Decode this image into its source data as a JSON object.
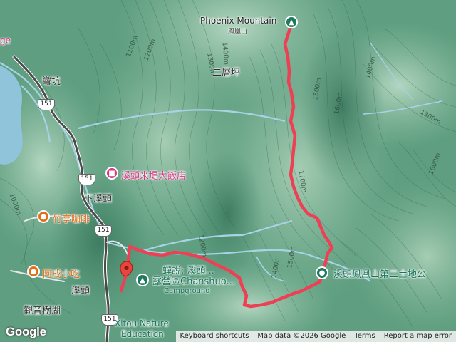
{
  "map": {
    "peak": {
      "name_en": "Phoenix Mountain",
      "name_zh": "鳳凰山",
      "icon": "mountain-peak-icon"
    },
    "places": {
      "wankeng": "彎坑",
      "erchengping": "二層坪",
      "xiaxitou": "下溪頭",
      "xitou": "溪頭",
      "guanyinshuhu": "觀音樹湖"
    },
    "pois": {
      "hotel": {
        "label": "溪頭米堤大飯店",
        "icon": "hotel-icon"
      },
      "cafe": {
        "label": "竹亭咖啡",
        "icon": "cafe-icon"
      },
      "eatery": {
        "label": "阿成小吃",
        "icon": "restaurant-icon"
      },
      "campground": {
        "line1": "蟬說: 溪頭...",
        "line2": "露營區Chanshuo...",
        "line3": "Campground",
        "icon": "campground-icon"
      },
      "shrine": {
        "label": "溪頭鳳凰山第二土地公",
        "icon": "place-icon"
      },
      "nature": {
        "line1": "Xitou Nature",
        "line2": "Education"
      }
    },
    "roads": [
      "151",
      "151",
      "151",
      "151"
    ],
    "edge_label": "ge",
    "contours": [
      "1100m",
      "1200m",
      "1300m",
      "1400m",
      "1400m",
      "1500m",
      "1600m",
      "1700m",
      "1300m",
      "1200m",
      "1000m",
      "1400m",
      "1500m",
      "1600m"
    ],
    "route_color": "#ee4055",
    "start_marker": "location-pin-icon"
  },
  "footer": {
    "logo": "Google",
    "shortcuts": "Keyboard shortcuts",
    "map_data": "Map data ©2026 Google",
    "terms": "Terms",
    "report": "Report a map error"
  }
}
